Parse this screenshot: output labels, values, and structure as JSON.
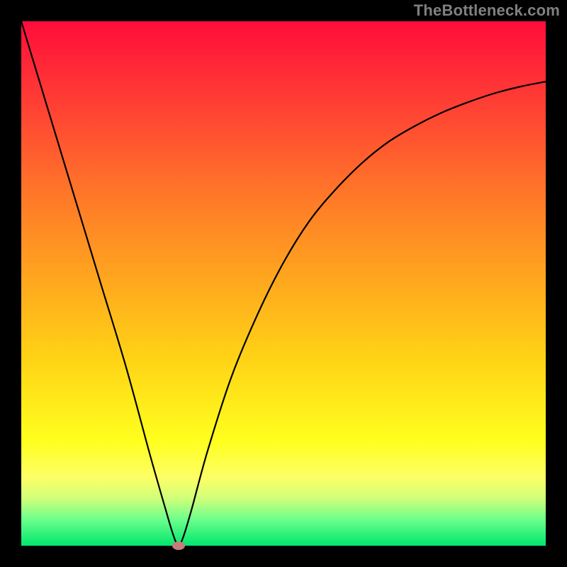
{
  "watermark": "TheBottleneck.com",
  "chart_data": {
    "type": "line",
    "title": "",
    "xlabel": "",
    "ylabel": "",
    "xlim": [
      0,
      1
    ],
    "ylim": [
      0,
      1
    ],
    "grid": false,
    "legend": false,
    "note": "Axes are normalized 0–1; original chart has no visible tick labels or axis titles.",
    "series": [
      {
        "name": "bottleneck-curve",
        "x": [
          0.0,
          0.05,
          0.1,
          0.15,
          0.2,
          0.245,
          0.275,
          0.29,
          0.3,
          0.31,
          0.325,
          0.355,
          0.4,
          0.45,
          0.5,
          0.55,
          0.6,
          0.65,
          0.7,
          0.75,
          0.8,
          0.85,
          0.9,
          0.95,
          1.0
        ],
        "y": [
          1.0,
          0.835,
          0.67,
          0.505,
          0.34,
          0.175,
          0.07,
          0.02,
          0.0,
          0.02,
          0.07,
          0.18,
          0.32,
          0.44,
          0.54,
          0.62,
          0.68,
          0.73,
          0.77,
          0.8,
          0.825,
          0.845,
          0.862,
          0.875,
          0.885
        ]
      }
    ],
    "marker": {
      "x": 0.3,
      "y": 0.0,
      "label": "bottleneck-minimum"
    },
    "background_gradient": {
      "orientation": "vertical",
      "stops": [
        {
          "pos": 0.0,
          "color": "#ff0d3b"
        },
        {
          "pos": 0.2,
          "color": "#ff5a30"
        },
        {
          "pos": 0.5,
          "color": "#ffb21e"
        },
        {
          "pos": 0.8,
          "color": "#ffff1e"
        },
        {
          "pos": 1.0,
          "color": "#00e66d"
        }
      ]
    }
  }
}
